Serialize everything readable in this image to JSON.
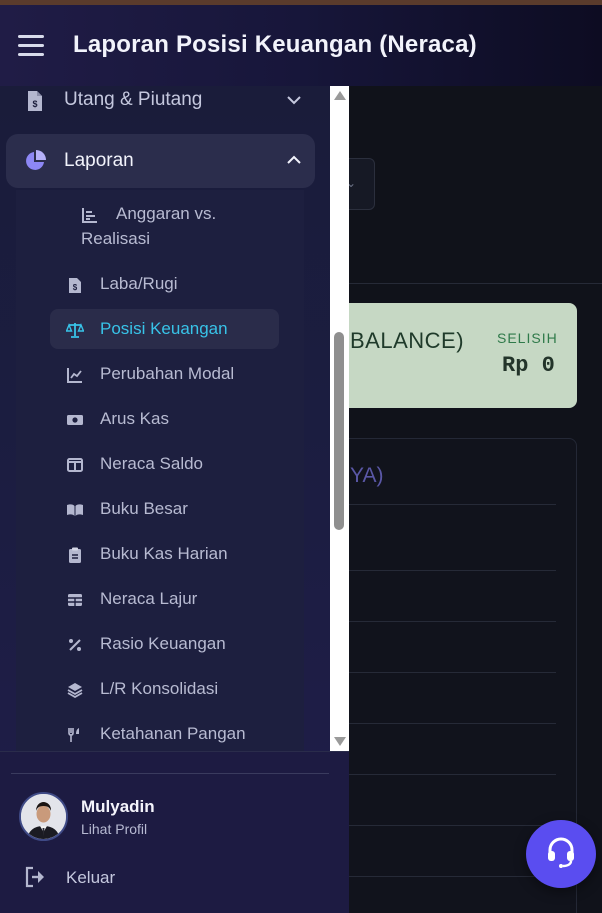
{
  "header": {
    "title": "Laporan Posisi Keuangan (Neraca)"
  },
  "main": {
    "balance_text": "BALANCE)",
    "selisih_label": "SELISIH",
    "selisih_value": "Rp 0",
    "table_heading_fragment": "YA)"
  },
  "sidebar": {
    "items": [
      {
        "label": "Utang & Piutang",
        "icon": "file-dollar-icon",
        "expanded": false
      },
      {
        "label": "Laporan",
        "icon": "pie-chart-icon",
        "expanded": true
      }
    ],
    "submenu": [
      {
        "label_line1": "Anggaran vs.",
        "label_line2": "Realisasi",
        "icon": "bar-chart-icon"
      },
      {
        "label": "Laba/Rugi",
        "icon": "file-invoice-icon"
      },
      {
        "label": "Posisi Keuangan",
        "icon": "balance-scale-icon",
        "active": true
      },
      {
        "label": "Perubahan Modal",
        "icon": "line-chart-icon"
      },
      {
        "label": "Arus Kas",
        "icon": "money-bill-icon"
      },
      {
        "label": "Neraca Saldo",
        "icon": "columns-icon"
      },
      {
        "label": "Buku Besar",
        "icon": "book-open-icon"
      },
      {
        "label": "Buku Kas Harian",
        "icon": "clipboard-icon"
      },
      {
        "label": "Neraca Lajur",
        "icon": "table-icon"
      },
      {
        "label": "Rasio Keuangan",
        "icon": "percent-icon"
      },
      {
        "label": "L/R Konsolidasi",
        "icon": "layers-icon"
      },
      {
        "label": "Ketahanan Pangan",
        "icon": "utensils-icon"
      }
    ]
  },
  "footer": {
    "user_name": "Mulyadin",
    "profile_link": "Lihat Profil",
    "logout_label": "Keluar"
  },
  "colors": {
    "accent": "#5a4df0",
    "active_text": "#38c3e8",
    "sidebar_bg": "#1a1c3a",
    "balance_card": "#c6d8c4"
  }
}
